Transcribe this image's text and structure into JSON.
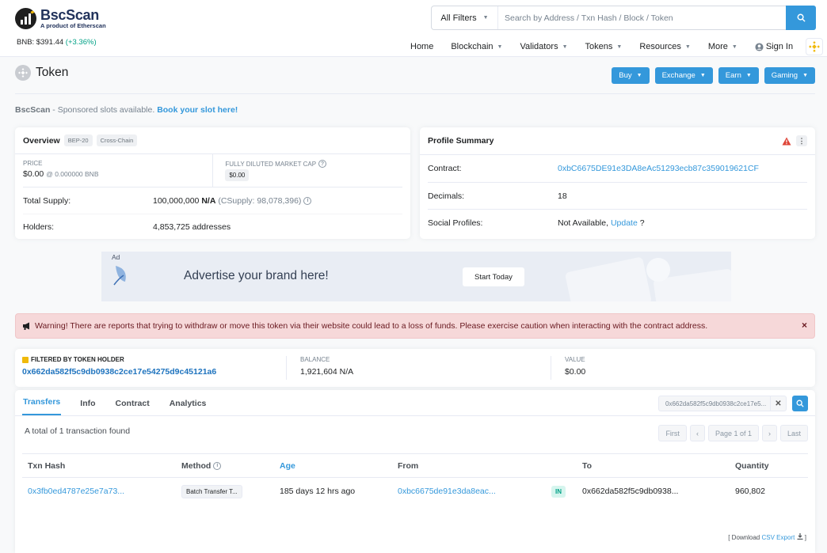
{
  "header": {
    "logo_title": "BscScan",
    "logo_subtitle": "A product of Etherscan",
    "price_label": "BNB: $391.44",
    "price_change": "(+3.36%)",
    "search_filter": "All Filters",
    "search_placeholder": "Search by Address / Txn Hash / Block / Token",
    "nav": [
      "Home",
      "Blockchain",
      "Validators",
      "Tokens",
      "Resources",
      "More"
    ],
    "signin": "Sign In"
  },
  "page": {
    "title": "Token",
    "buttons": [
      "Buy",
      "Exchange",
      "Earn",
      "Gaming"
    ]
  },
  "sponsor": {
    "brand": "BscScan",
    "text": " - Sponsored slots available. ",
    "link": "Book your slot here!"
  },
  "overview": {
    "title": "Overview",
    "badges": [
      "BEP-20",
      "Cross-Chain"
    ],
    "price_label": "PRICE",
    "price_value": "$0.00",
    "price_sub": "@ 0.000000 BNB",
    "mcap_label": "FULLY DILUTED MARKET CAP",
    "mcap_value": "$0.00",
    "supply_label": "Total Supply:",
    "supply_value": "100,000,000",
    "supply_unit": "N/A",
    "csupply": "(CSupply: 98,078,396)",
    "holders_label": "Holders:",
    "holders_value": "4,853,725 addresses"
  },
  "profile": {
    "title": "Profile Summary",
    "contract_label": "Contract:",
    "contract_value": "0xbC6675DE91e3DA8eAc51293ecb87c359019621CF",
    "decimals_label": "Decimals:",
    "decimals_value": "18",
    "social_label": "Social Profiles:",
    "social_value": "Not Available,",
    "social_link": "Update",
    "social_q": "?"
  },
  "ad": {
    "tag": "Ad",
    "text": "Advertise your brand here!",
    "button": "Start Today"
  },
  "warning": {
    "text": "Warning! There are reports that trying to withdraw or move this token via their website could lead to a loss of funds. Please exercise caution when interacting with the contract address.",
    "close": "×"
  },
  "filtered": {
    "label": "FILTERED BY TOKEN HOLDER",
    "address": "0x662da582f5c9db0938c2ce17e54275d9c45121a6",
    "balance_label": "BALANCE",
    "balance_value": "1,921,604 N/A",
    "value_label": "VALUE",
    "value_value": "$0.00"
  },
  "transfers": {
    "tabs": [
      "Transfers",
      "Info",
      "Contract",
      "Analytics"
    ],
    "search_value": "0x662da582f5c9db0938c2ce17e5...",
    "count_text": "A total of 1 transaction found",
    "pager": [
      "First",
      "Page 1 of 1",
      "Last"
    ],
    "columns": [
      "Txn Hash",
      "Method",
      "Age",
      "From",
      "To",
      "Quantity"
    ],
    "rows": [
      {
        "hash": "0x3fb0ed4787e25e7a73...",
        "method": "Batch Transfer T...",
        "age": "185 days 12 hrs ago",
        "from": "0xbc6675de91e3da8eac...",
        "direction": "IN",
        "to": "0x662da582f5c9db0938...",
        "quantity": "960,802"
      }
    ],
    "csv_prefix": "[ Download",
    "csv_link": "CSV Export",
    "csv_suffix": "]"
  },
  "colors": {
    "accent": "#3498db",
    "brand_gold": "#f0b90b",
    "warning_bg": "#f6d8d9",
    "positive": "#00a186"
  }
}
